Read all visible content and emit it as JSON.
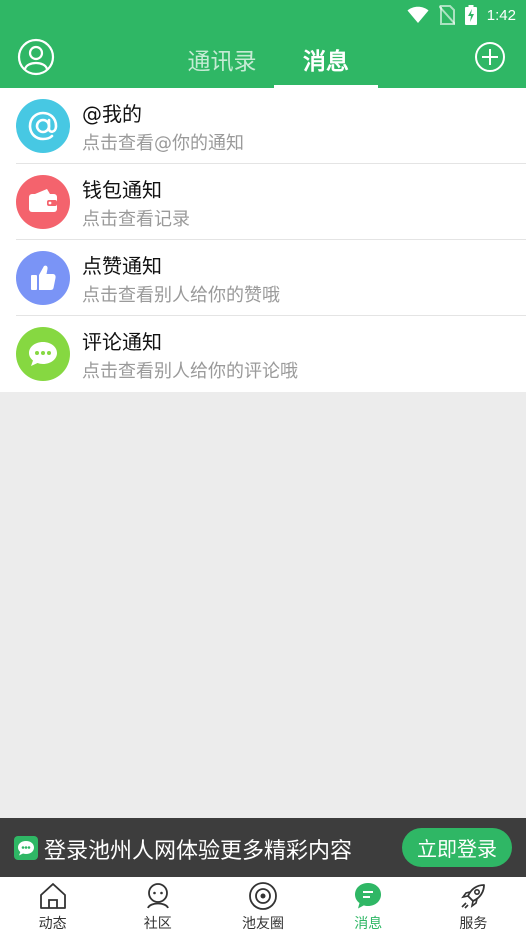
{
  "status_bar": {
    "time": "1:42"
  },
  "header": {
    "tabs": [
      {
        "label": "通讯录",
        "active": false
      },
      {
        "label": "消息",
        "active": true
      }
    ]
  },
  "messages": [
    {
      "title": "@我的",
      "subtitle": "点击查看@你的通知",
      "icon": "at-icon",
      "color": "#47c8e3"
    },
    {
      "title": "钱包通知",
      "subtitle": "点击查看记录",
      "icon": "wallet-icon",
      "color": "#f4636d"
    },
    {
      "title": "点赞通知",
      "subtitle": "点击查看别人给你的赞哦",
      "icon": "thumbs-up-icon",
      "color": "#7a94f6"
    },
    {
      "title": "评论通知",
      "subtitle": "点击查看别人给你的评论哦",
      "icon": "comment-icon",
      "color": "#86d841"
    }
  ],
  "login_banner": {
    "text": "登录池州人网体验更多精彩内容",
    "button": "立即登录"
  },
  "bottom_nav": [
    {
      "label": "动态",
      "icon": "home-icon",
      "active": false
    },
    {
      "label": "社区",
      "icon": "community-icon",
      "active": false
    },
    {
      "label": "池友圈",
      "icon": "friends-circle-icon",
      "active": false
    },
    {
      "label": "消息",
      "icon": "message-icon",
      "active": true
    },
    {
      "label": "服务",
      "icon": "rocket-icon",
      "active": false
    }
  ],
  "colors": {
    "brand": "#2fb765",
    "banner_bg": "#3d3d3d"
  }
}
